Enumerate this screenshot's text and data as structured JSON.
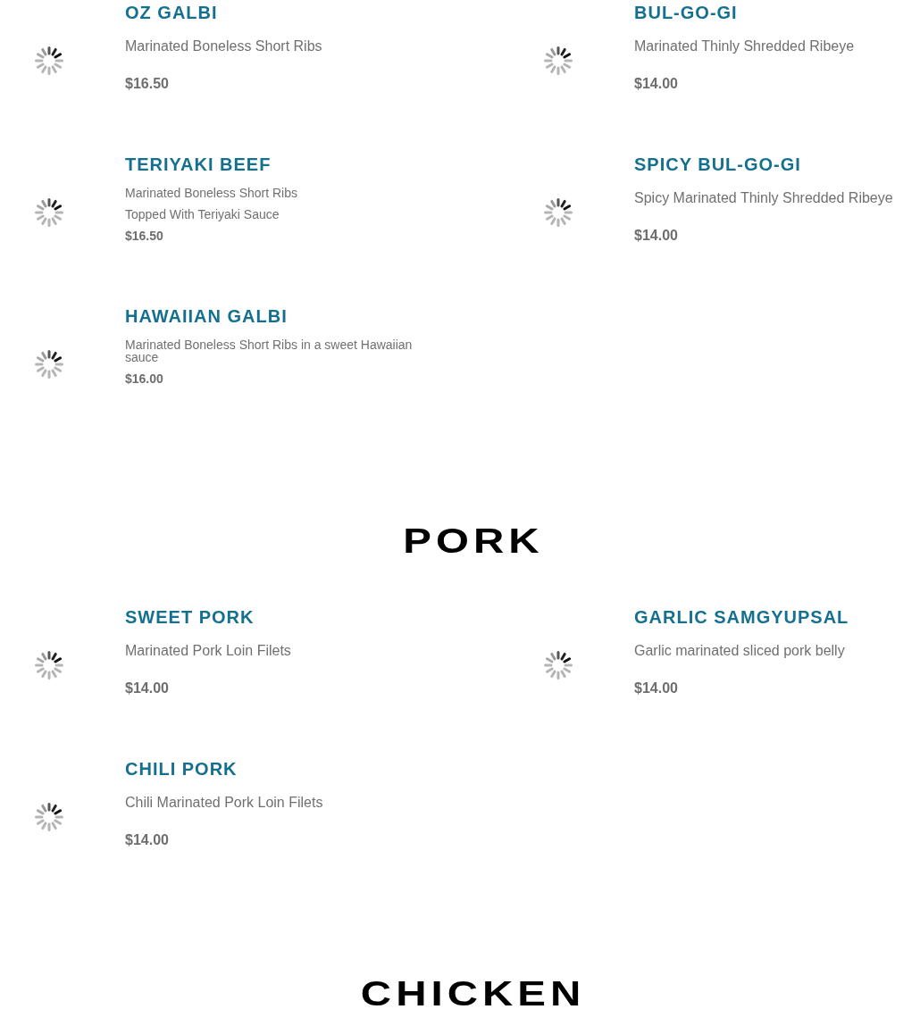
{
  "sections": [
    {
      "items": [
        {
          "kind": "standard",
          "title": "OZ GALBI",
          "description": [
            "Marinated Boneless Short Ribs"
          ],
          "price": "$16.50"
        },
        {
          "kind": "standard",
          "title": "BUL-GO-GI",
          "description": [
            "Marinated Thinly Shredded Ribeye"
          ],
          "price": "$14.00"
        },
        {
          "kind": "compact",
          "title": "TERIYAKI BEEF",
          "description": [
            "Marinated Boneless Short Ribs",
            "Topped With Teriyaki Sauce"
          ],
          "price": "$16.50"
        },
        {
          "kind": "standard",
          "title": "SPICY BUL-GO-GI",
          "description": [
            "Spicy Marinated Thinly Shredded Ribeye"
          ],
          "price": "$14.00"
        },
        {
          "kind": "dense",
          "title": "HAWAIIAN GALBI",
          "description": [
            "Marinated Boneless Short Ribs in a sweet Hawaiian sauce"
          ],
          "price": "$16.00"
        }
      ]
    },
    {
      "heading": "PORK",
      "items": [
        {
          "kind": "standard",
          "title": "SWEET PORK",
          "description": [
            "Marinated Pork Loin Filets"
          ],
          "price": "$14.00"
        },
        {
          "kind": "standard",
          "title": "GARLIC SAMGYUPSAL",
          "description": [
            "Garlic marinated sliced pork belly"
          ],
          "price": "$14.00"
        },
        {
          "kind": "standard",
          "title": "CHILI PORK",
          "description": [
            "Chili Marinated Pork Loin Filets"
          ],
          "price": "$14.00"
        }
      ]
    },
    {
      "heading": "CHICKEN"
    }
  ]
}
